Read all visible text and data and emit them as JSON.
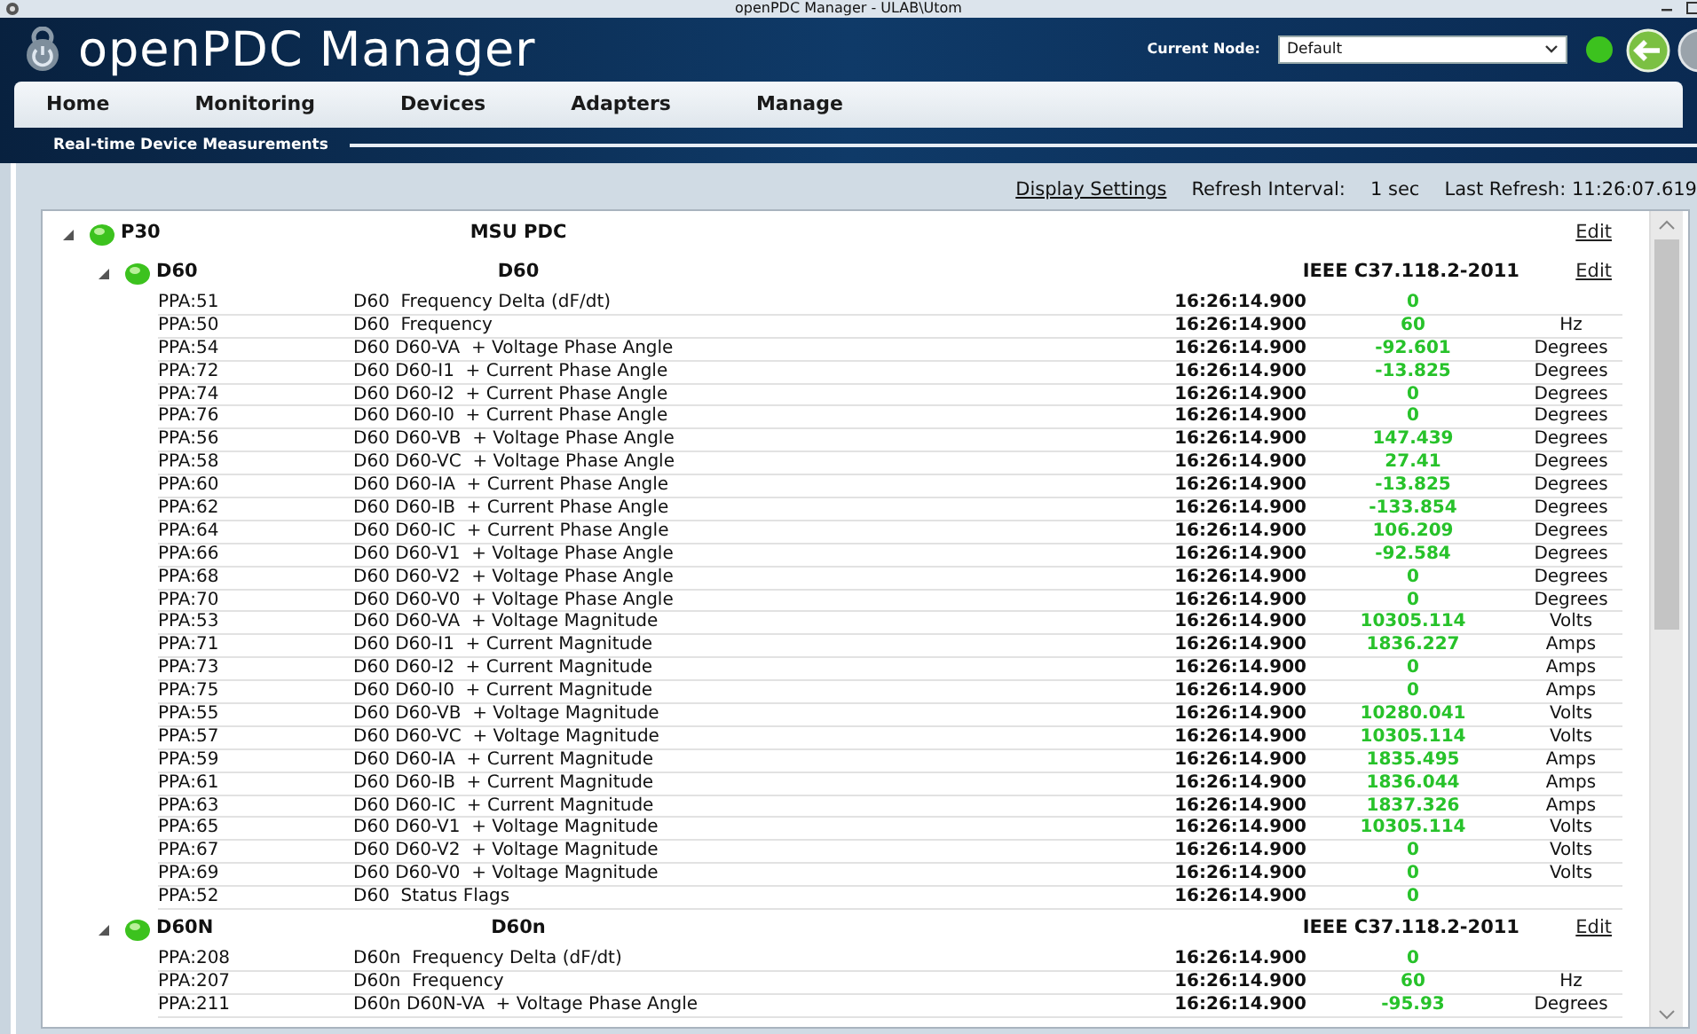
{
  "window": {
    "title": "openPDC Manager - ULAB\\Utom"
  },
  "app": {
    "title": "openPDC Manager",
    "current_node_label": "Current Node:",
    "current_node": "Default",
    "connected": true
  },
  "menu": [
    {
      "label": "Home"
    },
    {
      "label": "Monitoring"
    },
    {
      "label": "Devices"
    },
    {
      "label": "Adapters"
    },
    {
      "label": "Manage"
    }
  ],
  "panel": {
    "title": "Real-time Device Measurements"
  },
  "toolbar": {
    "display_settings": "Display Settings",
    "refresh_label": "Refresh Interval:",
    "refresh_value": "1 sec",
    "last_refresh": "Last Refresh: 11:26:07.619"
  },
  "tree": [
    {
      "name": "P30",
      "description": "MSU PDC",
      "edit": "Edit",
      "expanded": true,
      "online": true,
      "children": [
        {
          "name": "D60",
          "description": "D60",
          "protocol": "IEEE C37.118.2-2011",
          "edit": "Edit",
          "expanded": true,
          "online": true,
          "measurements": [
            {
              "id": "PPA:51",
              "label": "D60  Frequency Delta (dF/dt)",
              "time": "16:26:14.900",
              "value": "0"
            },
            {
              "id": "PPA:50",
              "label": "D60  Frequency",
              "time": "16:26:14.900",
              "value": "60",
              "unit": "Hz"
            },
            {
              "id": "PPA:54",
              "label": "D60 D60-VA  + Voltage Phase Angle",
              "time": "16:26:14.900",
              "value": "-92.601",
              "unit": "Degrees"
            },
            {
              "id": "PPA:72",
              "label": "D60 D60-I1  + Current Phase Angle",
              "time": "16:26:14.900",
              "value": "-13.825",
              "unit": "Degrees"
            },
            {
              "id": "PPA:74",
              "label": "D60 D60-I2  + Current Phase Angle",
              "time": "16:26:14.900",
              "value": "0",
              "unit": "Degrees"
            },
            {
              "id": "PPA:76",
              "label": "D60 D60-I0  + Current Phase Angle",
              "time": "16:26:14.900",
              "value": "0",
              "unit": "Degrees"
            },
            {
              "id": "PPA:56",
              "label": "D60 D60-VB  + Voltage Phase Angle",
              "time": "16:26:14.900",
              "value": "147.439",
              "unit": "Degrees"
            },
            {
              "id": "PPA:58",
              "label": "D60 D60-VC  + Voltage Phase Angle",
              "time": "16:26:14.900",
              "value": "27.41",
              "unit": "Degrees"
            },
            {
              "id": "PPA:60",
              "label": "D60 D60-IA  + Current Phase Angle",
              "time": "16:26:14.900",
              "value": "-13.825",
              "unit": "Degrees"
            },
            {
              "id": "PPA:62",
              "label": "D60 D60-IB  + Current Phase Angle",
              "time": "16:26:14.900",
              "value": "-133.854",
              "unit": "Degrees"
            },
            {
              "id": "PPA:64",
              "label": "D60 D60-IC  + Current Phase Angle",
              "time": "16:26:14.900",
              "value": "106.209",
              "unit": "Degrees"
            },
            {
              "id": "PPA:66",
              "label": "D60 D60-V1  + Voltage Phase Angle",
              "time": "16:26:14.900",
              "value": "-92.584",
              "unit": "Degrees"
            },
            {
              "id": "PPA:68",
              "label": "D60 D60-V2  + Voltage Phase Angle",
              "time": "16:26:14.900",
              "value": "0",
              "unit": "Degrees"
            },
            {
              "id": "PPA:70",
              "label": "D60 D60-V0  + Voltage Phase Angle",
              "time": "16:26:14.900",
              "value": "0",
              "unit": "Degrees"
            },
            {
              "id": "PPA:53",
              "label": "D60 D60-VA  + Voltage Magnitude",
              "time": "16:26:14.900",
              "value": "10305.114",
              "unit": "Volts"
            },
            {
              "id": "PPA:71",
              "label": "D60 D60-I1  + Current Magnitude",
              "time": "16:26:14.900",
              "value": "1836.227",
              "unit": "Amps"
            },
            {
              "id": "PPA:73",
              "label": "D60 D60-I2  + Current Magnitude",
              "time": "16:26:14.900",
              "value": "0",
              "unit": "Amps"
            },
            {
              "id": "PPA:75",
              "label": "D60 D60-I0  + Current Magnitude",
              "time": "16:26:14.900",
              "value": "0",
              "unit": "Amps"
            },
            {
              "id": "PPA:55",
              "label": "D60 D60-VB  + Voltage Magnitude",
              "time": "16:26:14.900",
              "value": "10280.041",
              "unit": "Volts"
            },
            {
              "id": "PPA:57",
              "label": "D60 D60-VC  + Voltage Magnitude",
              "time": "16:26:14.900",
              "value": "10305.114",
              "unit": "Volts"
            },
            {
              "id": "PPA:59",
              "label": "D60 D60-IA  + Current Magnitude",
              "time": "16:26:14.900",
              "value": "1835.495",
              "unit": "Amps"
            },
            {
              "id": "PPA:61",
              "label": "D60 D60-IB  + Current Magnitude",
              "time": "16:26:14.900",
              "value": "1836.044",
              "unit": "Amps"
            },
            {
              "id": "PPA:63",
              "label": "D60 D60-IC  + Current Magnitude",
              "time": "16:26:14.900",
              "value": "1837.326",
              "unit": "Amps"
            },
            {
              "id": "PPA:65",
              "label": "D60 D60-V1  + Voltage Magnitude",
              "time": "16:26:14.900",
              "value": "10305.114",
              "unit": "Volts"
            },
            {
              "id": "PPA:67",
              "label": "D60 D60-V2  + Voltage Magnitude",
              "time": "16:26:14.900",
              "value": "0",
              "unit": "Volts"
            },
            {
              "id": "PPA:69",
              "label": "D60 D60-V0  + Voltage Magnitude",
              "time": "16:26:14.900",
              "value": "0",
              "unit": "Volts"
            },
            {
              "id": "PPA:52",
              "label": "D60  Status Flags",
              "time": "16:26:14.900",
              "value": "0"
            }
          ]
        },
        {
          "name": "D60N",
          "description": "D60n",
          "protocol": "IEEE C37.118.2-2011",
          "edit": "Edit",
          "expanded": true,
          "online": true,
          "measurements": [
            {
              "id": "PPA:208",
              "label": "D60n  Frequency Delta (dF/dt)",
              "time": "16:26:14.900",
              "value": "0"
            },
            {
              "id": "PPA:207",
              "label": "D60n  Frequency",
              "time": "16:26:14.900",
              "value": "60",
              "unit": "Hz"
            },
            {
              "id": "PPA:211",
              "label": "D60n D60N-VA  + Voltage Phase Angle",
              "time": "16:26:14.900",
              "value": "-95.93",
              "unit": "Degrees"
            }
          ]
        }
      ]
    }
  ]
}
